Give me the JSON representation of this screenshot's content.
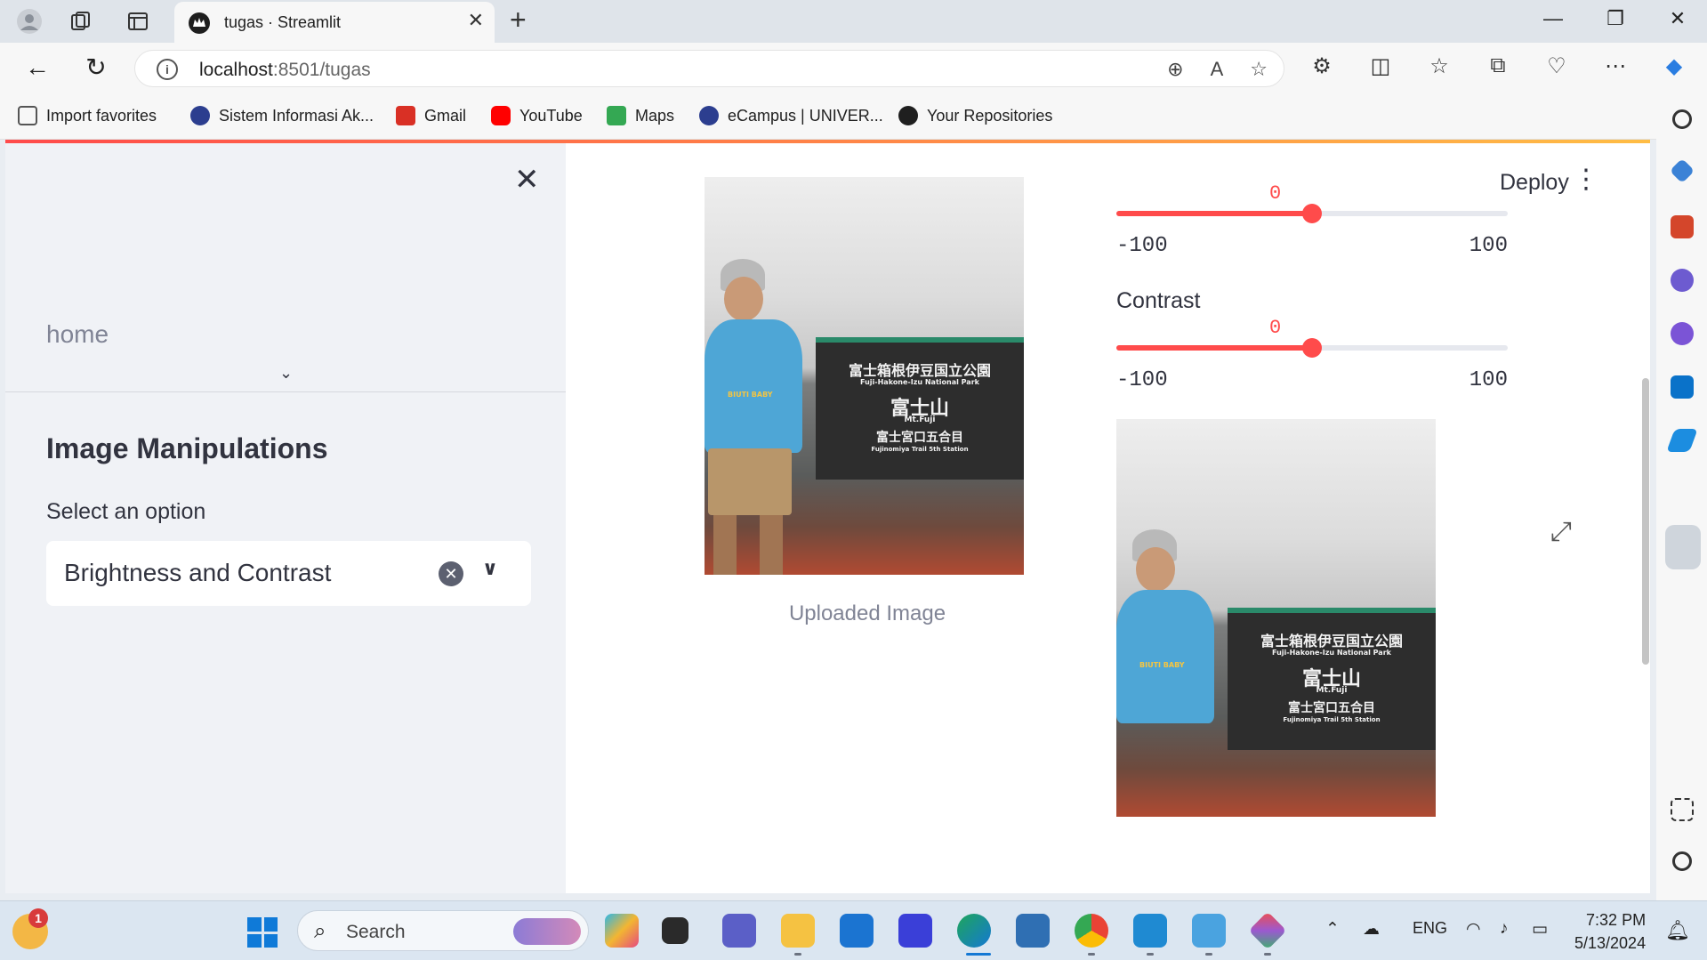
{
  "browser": {
    "tab_title": "tugas · Streamlit",
    "url_host": "localhost",
    "url_path": ":8501/tugas",
    "bookmarks": [
      {
        "label": "Import favorites",
        "color": "#555555"
      },
      {
        "label": "Sistem Informasi Ak...",
        "color": "#2c3e8f"
      },
      {
        "label": "Gmail",
        "color": "#d93025"
      },
      {
        "label": "YouTube",
        "color": "#ff0000"
      },
      {
        "label": "Maps",
        "color": "#34a853"
      },
      {
        "label": "eCampus | UNIVER...",
        "color": "#2c3e8f"
      },
      {
        "label": "Your Repositories",
        "color": "#1f1f1f"
      }
    ]
  },
  "sidebar": {
    "nav_item": "home",
    "heading": "Image Manipulations",
    "select_label": "Select an option",
    "select_value": "Brightness and Contrast"
  },
  "header": {
    "deploy_label": "Deploy"
  },
  "main": {
    "uploaded_caption": "Uploaded Image",
    "sign_title": "富士箱根伊豆国立公園",
    "sign_subtitle": "Fuji-Hakone-Izu National Park",
    "sign_name": "富士山",
    "sign_name_en": "Mt.Fuji",
    "sign_station": "富士宮口五合目",
    "sign_station_en": "Fujinomiya Trail 5th Station",
    "shirt_text": "BIUTI BABY",
    "brightness": {
      "value": "0",
      "min": "-100",
      "max": "100",
      "fraction": 0.5
    },
    "contrast": {
      "label": "Contrast",
      "value": "0",
      "min": "-100",
      "max": "100",
      "fraction": 0.5
    }
  },
  "taskbar": {
    "search_placeholder": "Search",
    "notification_count": "1",
    "language": "ENG",
    "time": "7:32 PM",
    "date": "5/13/2024"
  },
  "colors": {
    "accent": "#ff4b4b",
    "sidebar_bg": "#f0f2f6",
    "text": "#31333f"
  }
}
